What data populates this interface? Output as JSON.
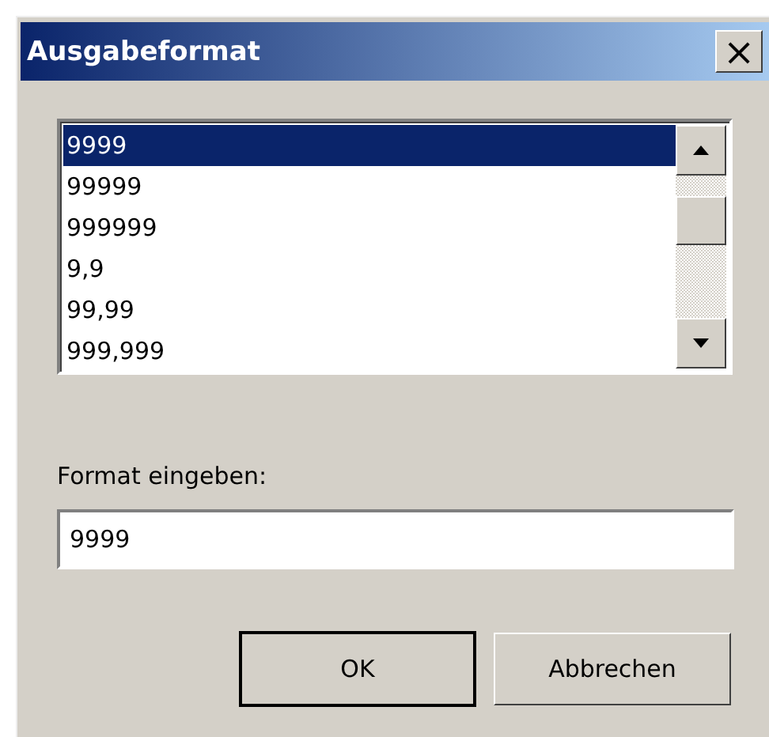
{
  "window": {
    "title": "Ausgabeformat",
    "close": "×"
  },
  "format_list": {
    "items": [
      {
        "label": "9999",
        "selected": true
      },
      {
        "label": "99999",
        "selected": false
      },
      {
        "label": "999999",
        "selected": false
      },
      {
        "label": "9,9",
        "selected": false
      },
      {
        "label": "99,99",
        "selected": false
      },
      {
        "label": "999,999",
        "selected": false
      }
    ]
  },
  "format_field": {
    "label": "Format eingeben:",
    "value": "9999"
  },
  "buttons": [
    {
      "label": "OK",
      "default": true
    },
    {
      "label": "Abbrechen",
      "default": false
    }
  ]
}
